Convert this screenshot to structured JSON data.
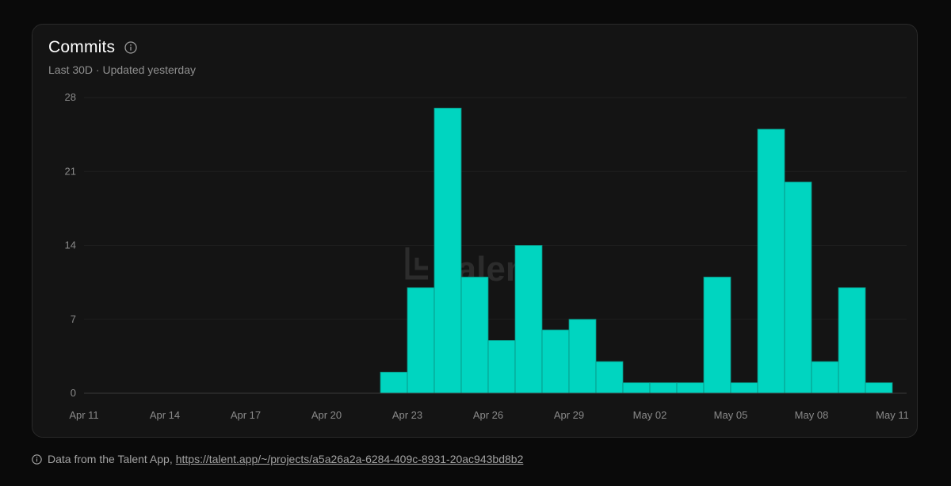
{
  "card": {
    "title": "Commits",
    "subtitle": "Last 30D · Updated yesterday"
  },
  "watermark": "talent",
  "footer": {
    "text": "Data from the Talent App,",
    "link": "https://talent.app/~/projects/a5a26a2a-6284-409c-8931-20ac943bd8b2"
  },
  "colors": {
    "bar": "#00d5c0",
    "background": "#0a0a0a",
    "card": "#141414"
  },
  "chart_data": {
    "type": "bar",
    "title": "Commits",
    "x": [
      "Apr 11",
      "Apr 12",
      "Apr 13",
      "Apr 14",
      "Apr 15",
      "Apr 16",
      "Apr 17",
      "Apr 18",
      "Apr 19",
      "Apr 20",
      "Apr 21",
      "Apr 22",
      "Apr 23",
      "Apr 24",
      "Apr 25",
      "Apr 26",
      "Apr 27",
      "Apr 28",
      "Apr 29",
      "Apr 30",
      "May 01",
      "May 02",
      "May 03",
      "May 04",
      "May 05",
      "May 06",
      "May 07",
      "May 08",
      "May 09",
      "May 10"
    ],
    "values": [
      0,
      0,
      0,
      0,
      0,
      0,
      0,
      0,
      0,
      0,
      0,
      2,
      10,
      27,
      11,
      5,
      14,
      6,
      7,
      3,
      1,
      1,
      1,
      11,
      1,
      25,
      20,
      3,
      10,
      1
    ],
    "x_ticks": [
      "Apr 11",
      "Apr 14",
      "Apr 17",
      "Apr 20",
      "Apr 23",
      "Apr 26",
      "Apr 29",
      "May 02",
      "May 05",
      "May 08",
      "May 11"
    ],
    "y_ticks": [
      0,
      7,
      14,
      21,
      28
    ],
    "ylim": [
      0,
      28
    ],
    "grid": true
  }
}
